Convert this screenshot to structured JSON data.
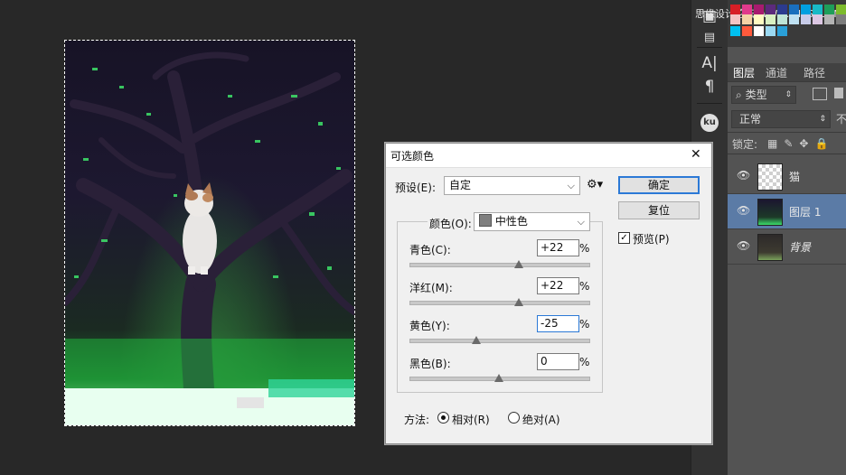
{
  "watermark": "思缘设计论坛 WWW.MISSYUAN.COM",
  "dialog": {
    "title": "可选颜色",
    "close_glyph": "✕",
    "preset_label": "预设(E):",
    "preset_value": "自定",
    "colors_label": "颜色(O):",
    "colors_value": "中性色",
    "sliders": [
      {
        "label": "青色(C):",
        "value": "+22",
        "unit": "%",
        "level": 22
      },
      {
        "label": "洋红(M):",
        "value": "+22",
        "unit": "%",
        "level": 22
      },
      {
        "label": "黄色(Y):",
        "value": "-25",
        "unit": "%",
        "level": -25
      },
      {
        "label": "黑色(B):",
        "value": "0",
        "unit": "%",
        "level": 0
      }
    ],
    "method_label": "方法:",
    "method_relative": "相对(R)",
    "method_absolute": "绝对(A)",
    "method_selected": "relative",
    "ok_label": "确定",
    "reset_label": "复位",
    "preview_label": "预览(P)",
    "preview_checked": true
  },
  "panel": {
    "tabs": [
      "图层",
      "通道",
      "路径"
    ],
    "filter_label": "类型",
    "blend_mode": "正常",
    "opacity_stub": "不",
    "lock_label": "锁定:",
    "layers": [
      {
        "name": "猫",
        "selected": false
      },
      {
        "name": "图层 1",
        "selected": true
      },
      {
        "name": "背景",
        "selected": false
      }
    ]
  },
  "colors": {
    "accent": "#2b79d6",
    "selected_layer": "#5b7ba6",
    "panel_bg": "#535353"
  }
}
